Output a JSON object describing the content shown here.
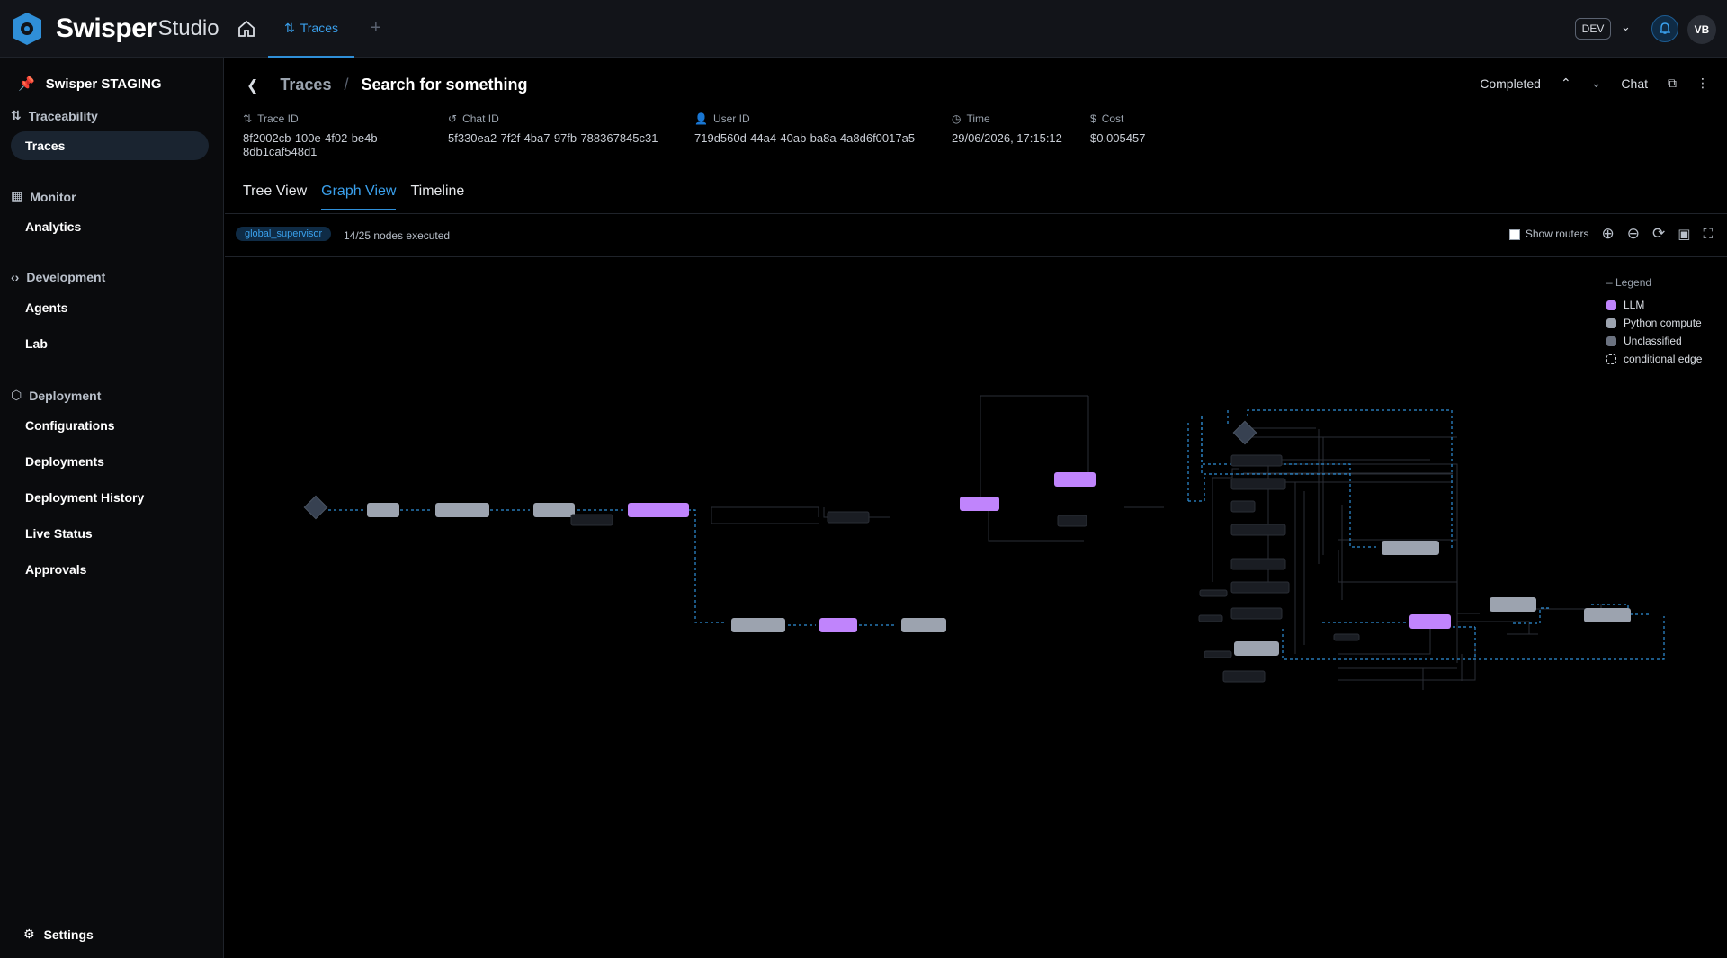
{
  "app": {
    "name": "Swisper",
    "name_suffix": "Studio"
  },
  "topnav": {
    "tab_label": "Traces",
    "env": "DEV",
    "avatar": "VB"
  },
  "sidebar": {
    "project": "Swisper STAGING",
    "sections": [
      {
        "title": "Traceability",
        "items": [
          "Traces"
        ]
      },
      {
        "title": "Monitor",
        "items": [
          "Analytics"
        ]
      },
      {
        "title": "Development",
        "items": [
          "Agents",
          "Lab"
        ]
      },
      {
        "title": "Deployment",
        "items": [
          "Configurations",
          "Deployments",
          "Deployment History",
          "Live Status",
          "Approvals"
        ]
      }
    ],
    "settings": "Settings"
  },
  "header": {
    "crumb_parent": "Traces",
    "crumb_current": "Search for something",
    "status": "Completed",
    "chat_label": "Chat"
  },
  "meta": {
    "trace_id_label": "Trace ID",
    "trace_id": "8f2002cb-100e-4f02-be4b-8db1caf548d1",
    "chat_id_label": "Chat ID",
    "chat_id": "5f330ea2-7f2f-4ba7-97fb-788367845c31",
    "user_id_label": "User ID",
    "user_id": "719d560d-44a4-40ab-ba8a-4a8d6f0017a5",
    "time_label": "Time",
    "time": "29/06/2026, 17:15:12",
    "cost_label": "Cost",
    "cost": "$0.005457"
  },
  "view_tabs": [
    "Tree View",
    "Graph View",
    "Timeline"
  ],
  "toolbar": {
    "supervisor": "global_supervisor",
    "executed": "14/25 nodes executed",
    "show_routers": "Show routers"
  },
  "legend": {
    "title": "– Legend",
    "items": [
      {
        "label": "LLM",
        "color": "#c084fc"
      },
      {
        "label": "Python compute",
        "color": "#9ca3af"
      },
      {
        "label": "Unclassified",
        "color": "#6b7280"
      },
      {
        "label": "conditional edge",
        "color": "#d1d5db"
      }
    ]
  },
  "colors": {
    "accent": "#2f8fd8",
    "llm": "#c084fc",
    "python": "#9ca3af",
    "bg": "#000000"
  }
}
